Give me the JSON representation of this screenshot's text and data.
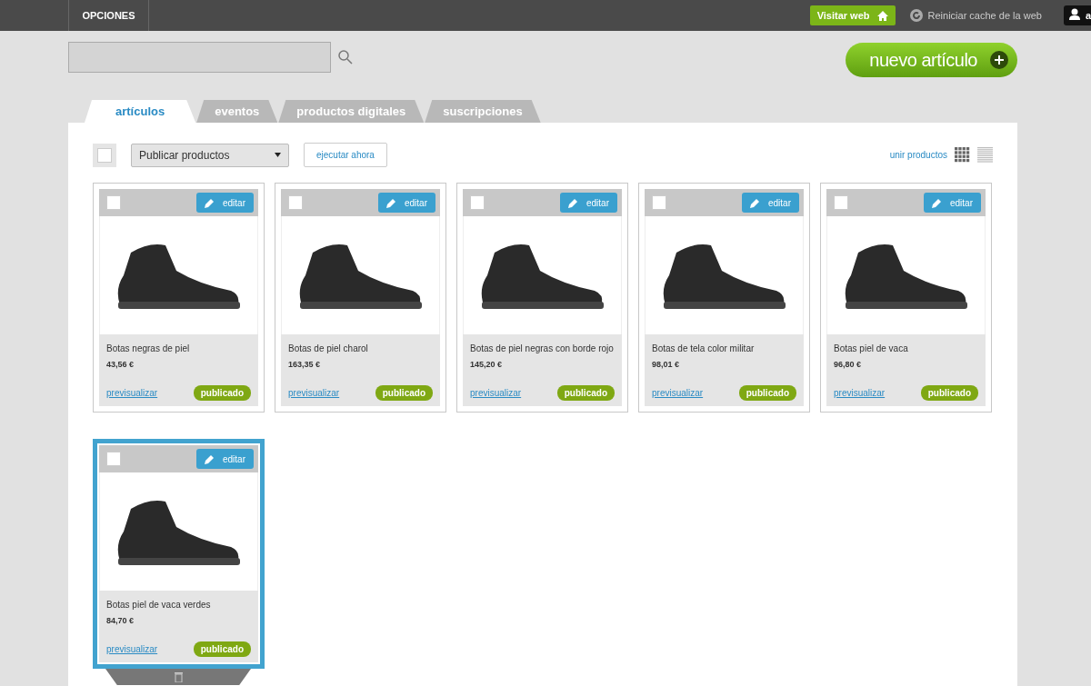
{
  "topbar": {
    "menu": "OPCIONES",
    "visit_button": "Visitar web",
    "cache_link": "Reiniciar cache de la web",
    "user": "a"
  },
  "new_button": "nuevo artículo",
  "tabs": [
    {
      "label": "artículos",
      "selected": true
    },
    {
      "label": "eventos",
      "selected": false
    },
    {
      "label": "productos digitales",
      "selected": false
    },
    {
      "label": "suscripciones",
      "selected": false
    }
  ],
  "toolbar": {
    "select_all_checked": false,
    "action": "Publicar productos",
    "run_button": "ejecutar ahora",
    "merge_link": "unir productos",
    "views": [
      {
        "kind": "grid",
        "selected": true
      },
      {
        "kind": "list",
        "selected": false
      }
    ]
  },
  "products": [
    {
      "name": "Botas negras de piel",
      "price": "43,56 €",
      "edit": "editar",
      "preview": "previsualizar",
      "status": "publicado",
      "checked": false,
      "highlighted": false
    },
    {
      "name": "Botas de piel charol",
      "price": "163,35 €",
      "edit": "editar",
      "preview": "previsualizar",
      "status": "publicado",
      "checked": false,
      "highlighted": false
    },
    {
      "name": "Botas de piel negras con borde rojo",
      "price": "145,20 €",
      "edit": "editar",
      "preview": "previsualizar",
      "status": "publicado",
      "checked": false,
      "highlighted": false
    },
    {
      "name": "Botas de tela color militar",
      "price": "98,01 €",
      "edit": "editar",
      "preview": "previsualizar",
      "status": "publicado",
      "checked": false,
      "highlighted": false
    },
    {
      "name": "Botas piel de vaca",
      "price": "96,80 €",
      "edit": "editar",
      "preview": "previsualizar",
      "status": "publicado",
      "checked": false,
      "highlighted": false
    },
    {
      "name": "Botas piel de vaca verdes",
      "price": "84,70 €",
      "edit": "editar",
      "preview": "previsualizar",
      "status": "publicado",
      "checked": false,
      "highlighted": true
    }
  ]
}
